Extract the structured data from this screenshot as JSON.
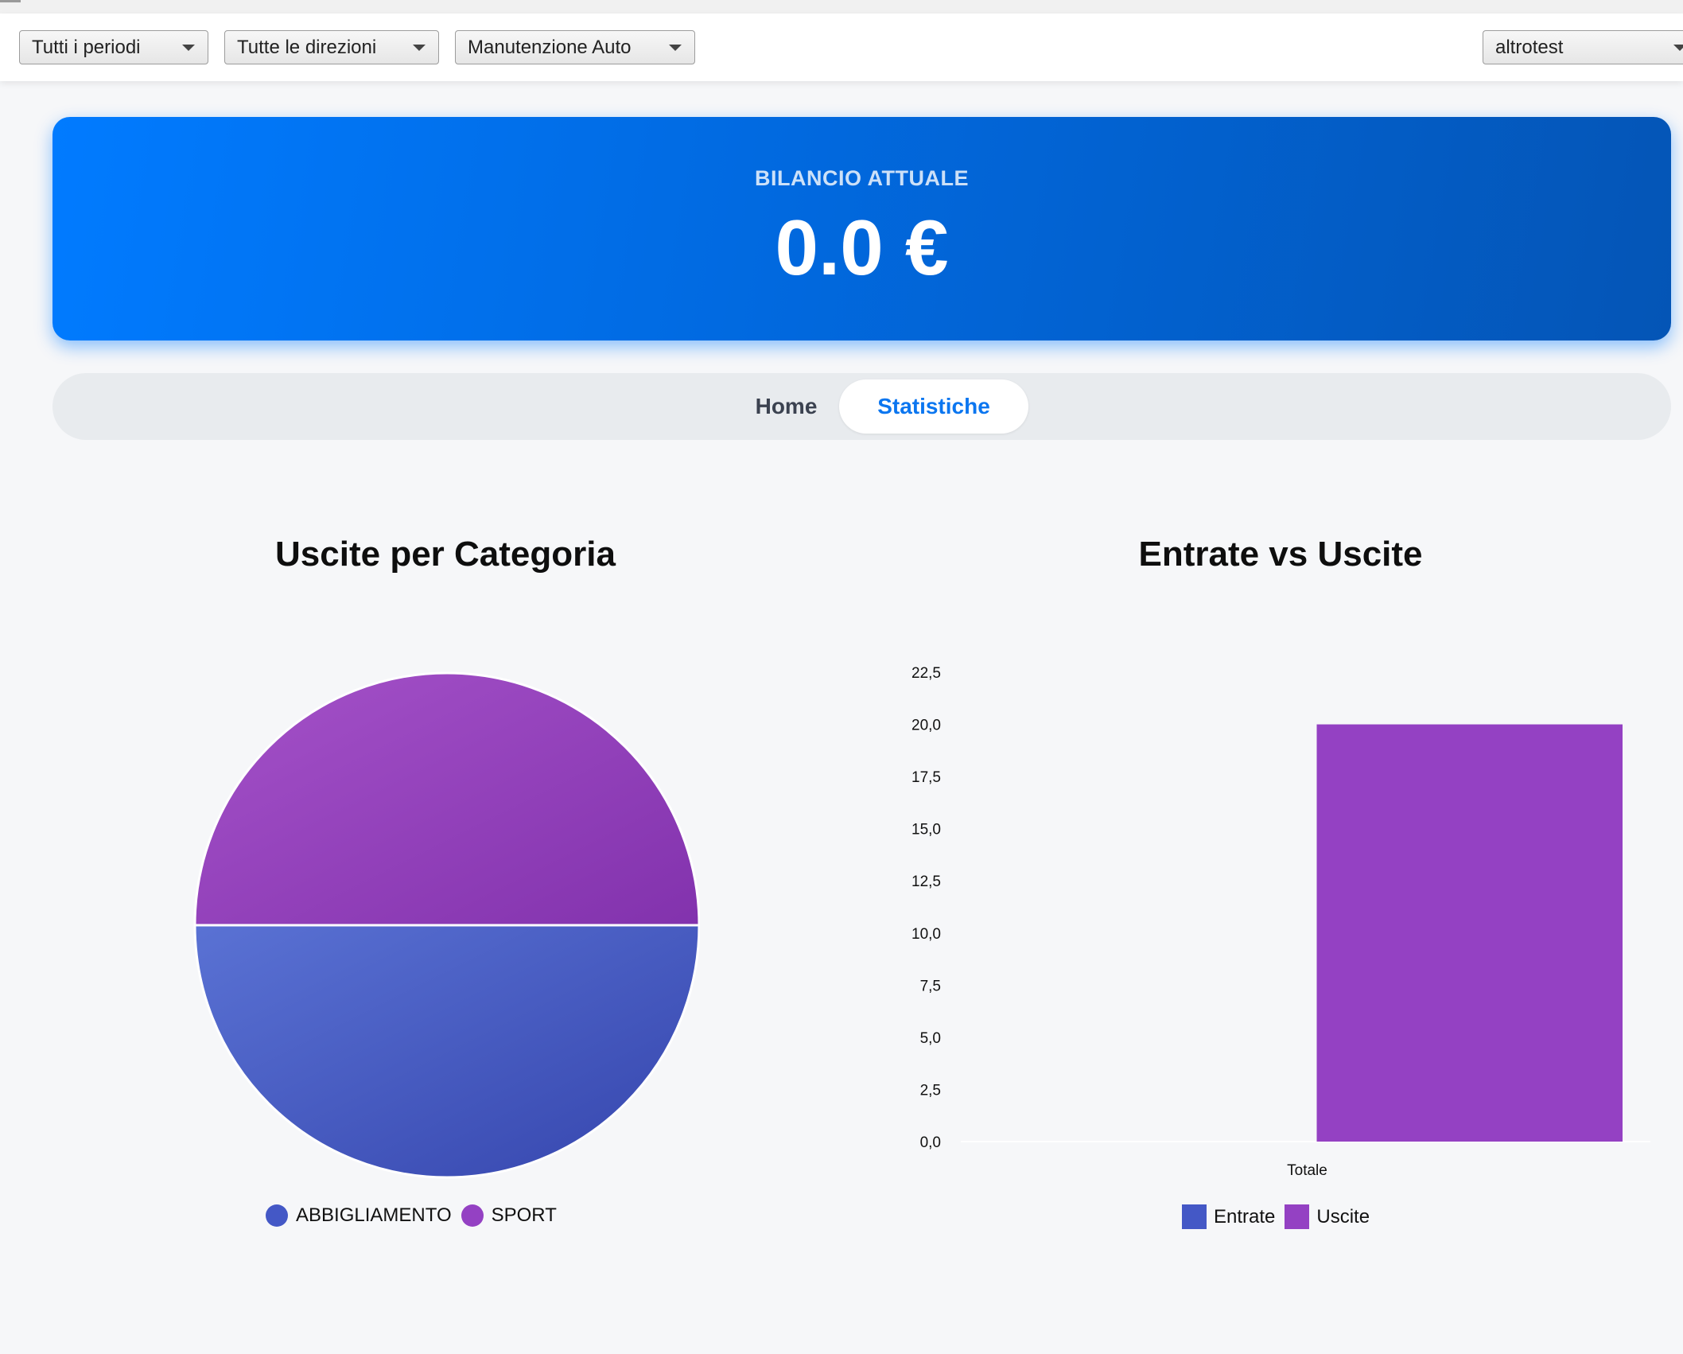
{
  "filters": {
    "period": "Tutti i periodi",
    "direction": "Tutte le direzioni",
    "category": "Manutenzione Auto",
    "account": "altrotest"
  },
  "balance": {
    "label": "BILANCIO ATTUALE",
    "value": "0.0 €"
  },
  "tabs": [
    {
      "label": "Home",
      "active": false
    },
    {
      "label": "Statistiche",
      "active": true
    }
  ],
  "colors": {
    "accent": "#0b76f0",
    "series_blue": "#4458c6",
    "series_purple": "#9441c3"
  },
  "chart_data": [
    {
      "type": "pie",
      "title": "Uscite per Categoria",
      "labels": [
        "ABBIGLIAMENTO",
        "SPORT"
      ],
      "values": [
        50,
        50
      ],
      "colors": [
        "#4458c6",
        "#9441c3"
      ],
      "legend": "bottom"
    },
    {
      "type": "bar",
      "title": "Entrate vs Uscite",
      "categories": [
        "Totale"
      ],
      "series": [
        {
          "name": "Entrate",
          "values": [
            0
          ],
          "color": "#4458c6"
        },
        {
          "name": "Uscite",
          "values": [
            20
          ],
          "color": "#9441c3"
        }
      ],
      "ylim": [
        0,
        22.5
      ],
      "yticks": [
        "0,0",
        "2,5",
        "5,0",
        "7,5",
        "10,0",
        "12,5",
        "15,0",
        "17,5",
        "20,0",
        "22,5"
      ],
      "grid": false,
      "legend": "bottom"
    }
  ]
}
